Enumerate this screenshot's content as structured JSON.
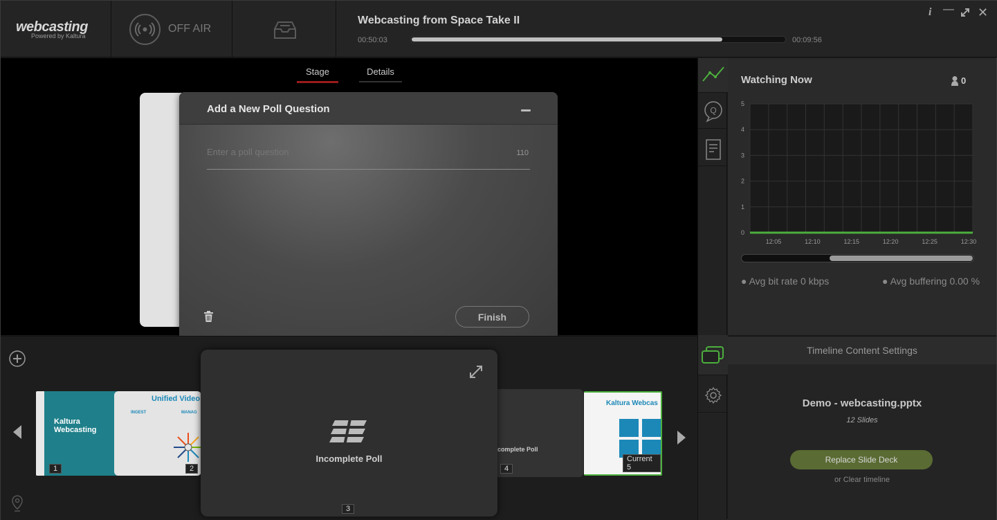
{
  "app": {
    "logo_main": "webcasting",
    "logo_sub": "Powered by Kaltura",
    "onair_label": "OFF AIR",
    "title": "Webcasting from Space Take II",
    "time_elapsed": "00:50:03",
    "time_remaining": "00:09:56",
    "progress_fraction": 0.83
  },
  "stage": {
    "tabs": [
      "Stage",
      "Details"
    ]
  },
  "poll": {
    "title": "Add a New Poll Question",
    "placeholder": "Enter a poll question",
    "char_count": "110",
    "finish_label": "Finish"
  },
  "analytics": {
    "title": "Watching Now",
    "viewer_count": "0",
    "avg_bitrate": "Avg bit rate 0 kbps",
    "avg_buffering": "Avg buffering 0.00 %"
  },
  "chart_data": {
    "type": "line",
    "x": [
      "12:05",
      "12:10",
      "12:15",
      "12:20",
      "12:25",
      "12:30"
    ],
    "series": [
      {
        "values": [
          0,
          0,
          0,
          0,
          0,
          0
        ]
      }
    ],
    "ylim": [
      0,
      5
    ],
    "yticks": [
      0,
      1,
      2,
      3,
      4,
      5
    ],
    "grid": true,
    "line_color": "#4caf3d"
  },
  "timeline": {
    "slides": [
      {
        "num": "1",
        "title": "Kaltura Webcasting"
      },
      {
        "num": "2",
        "title": "Unified Video",
        "sub1": "INGEST",
        "sub2": "MANAG"
      },
      {
        "num": "3",
        "title": "Incomplete Poll"
      },
      {
        "num": "4",
        "title": "complete Poll"
      },
      {
        "num": "Current 5",
        "title": "Kaltura Webcas"
      }
    ],
    "preview_label": "Incomplete Poll",
    "preview_num": "3"
  },
  "timeline_settings": {
    "header": "Timeline Content Settings",
    "deck_name": "Demo - webcasting.pptx",
    "slides_count": "12 Slides",
    "replace_label": "Replace Slide Deck",
    "clear_label": "or Clear timeline"
  },
  "colors": {
    "accent_green": "#4caf3d",
    "tab_underline": "#9b1b1b",
    "replace_button": "#5a6b33"
  }
}
